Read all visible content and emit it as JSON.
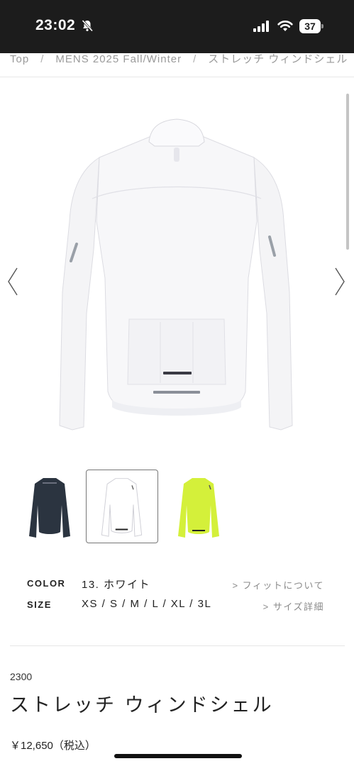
{
  "status_bar": {
    "time": "23:02",
    "battery": "37"
  },
  "breadcrumb": {
    "items": [
      "Top",
      "MENS 2025 Fall/Winter",
      "ストレッチ ウィンドシェル"
    ]
  },
  "gallery": {
    "thumbnail_colors": [
      "#2b3440",
      "#ffffff",
      "#d4f03a"
    ],
    "selected_index": 1
  },
  "specs": {
    "color_label": "COLOR",
    "color_value": "13. ホワイト",
    "fit_link": "> フィットについて",
    "size_label": "SIZE",
    "size_value": "XS / S / M / L / XL / 3L",
    "size_link": "> サイズ詳細"
  },
  "product": {
    "code": "2300",
    "name": "ストレッチ ウィンドシェル",
    "price": "￥12,650（税込）"
  }
}
